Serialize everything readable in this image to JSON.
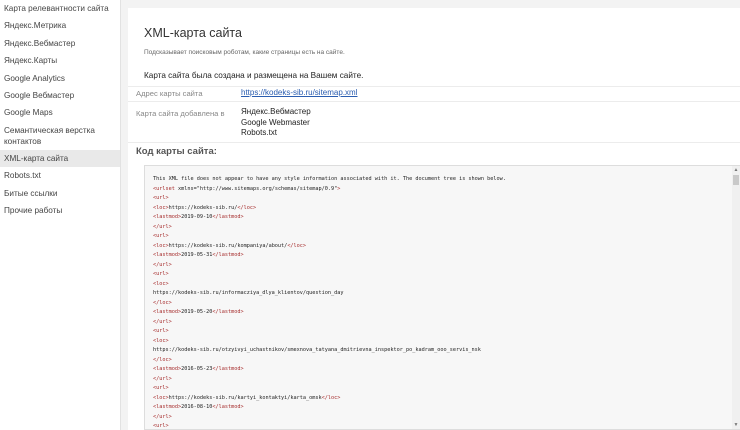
{
  "sidebar": {
    "items": [
      {
        "label": "Карта релевантности сайта"
      },
      {
        "label": "Яндекс.Метрика"
      },
      {
        "label": "Яндекс.Вебмастер"
      },
      {
        "label": "Яндекс.Карты"
      },
      {
        "label": "Google Analytics"
      },
      {
        "label": "Google Вебмастер"
      },
      {
        "label": "Google Maps"
      },
      {
        "label": "Семантическая верстка контактов"
      },
      {
        "label": "XML-карта сайта"
      },
      {
        "label": "Robots.txt"
      },
      {
        "label": "Битые ссылки"
      },
      {
        "label": "Прочие работы"
      }
    ]
  },
  "main": {
    "title": "XML-карта сайта",
    "subtitle": "Подсказывает поисковым роботам, какие страницы есть на сайте.",
    "success": "Карта сайта была создана и размещена на Вашем сайте.",
    "address_label": "Адрес карты сайта",
    "address_value": "https://kodeks-sib.ru/sitemap.xml",
    "added_label": "Карта сайта добавлена в",
    "added_values": [
      "Яндекс.Вебмастер",
      "Google Webmaster",
      "Robots.txt"
    ],
    "code_heading": "Код карты сайта:"
  },
  "code": {
    "lines": [
      {
        "t": "plain",
        "s": "This XML file does not appear to have any style information associated with it. The document tree is shown below."
      },
      {
        "t": "mixed",
        "a": "<urlset",
        "b": " xmlns=\"http://www.sitemaps.org/schemas/sitemap/0.9\"",
        "c": ">"
      },
      {
        "t": "tag",
        "s": "<url>"
      },
      {
        "t": "wrap",
        "o": "<loc>",
        "v": "https://kodeks-sib.ru/",
        "c": "</loc>"
      },
      {
        "t": "wrap",
        "o": "<lastmod>",
        "v": "2019-09-10",
        "c": "</lastmod>"
      },
      {
        "t": "tag",
        "s": "</url>"
      },
      {
        "t": "tag",
        "s": "<url>"
      },
      {
        "t": "wrap",
        "o": "<loc>",
        "v": "https://kodeks-sib.ru/kompaniya/about/",
        "c": "</loc>"
      },
      {
        "t": "wrap",
        "o": "<lastmod>",
        "v": "2019-05-31",
        "c": "</lastmod>"
      },
      {
        "t": "tag",
        "s": "</url>"
      },
      {
        "t": "tag",
        "s": "<url>"
      },
      {
        "t": "tag",
        "s": "<loc>"
      },
      {
        "t": "plain",
        "s": "https://kodeks-sib.ru/informacziya_dlya_klientov/question_day"
      },
      {
        "t": "tag",
        "s": "</loc>"
      },
      {
        "t": "wrap",
        "o": "<lastmod>",
        "v": "2019-05-20",
        "c": "</lastmod>"
      },
      {
        "t": "tag",
        "s": "</url>"
      },
      {
        "t": "tag",
        "s": "<url>"
      },
      {
        "t": "tag",
        "s": "<loc>"
      },
      {
        "t": "plain",
        "s": "https://kodeks-sib.ru/otzyivyi_uchastnikov/smexnova_tatyana_dmitrievna_inspektor_po_kadram_ooo_servis_nsk"
      },
      {
        "t": "tag",
        "s": "</loc>"
      },
      {
        "t": "wrap",
        "o": "<lastmod>",
        "v": "2016-05-23",
        "c": "</lastmod>"
      },
      {
        "t": "tag",
        "s": "</url>"
      },
      {
        "t": "tag",
        "s": "<url>"
      },
      {
        "t": "wrap",
        "o": "<loc>",
        "v": "https://kodeks-sib.ru/kartyi_kontaktyi/karta_omsk",
        "c": "</loc>"
      },
      {
        "t": "wrap",
        "o": "<lastmod>",
        "v": "2016-08-10",
        "c": "</lastmod>"
      },
      {
        "t": "tag",
        "s": "</url>"
      },
      {
        "t": "tag",
        "s": "<url>"
      }
    ]
  },
  "colors": {
    "tag": "#a52a2a",
    "link": "#2a5db0",
    "active_bg": "#e9e9e9"
  },
  "icons": {
    "scroll_up": "triangle-up",
    "scroll_down": "triangle-down"
  }
}
